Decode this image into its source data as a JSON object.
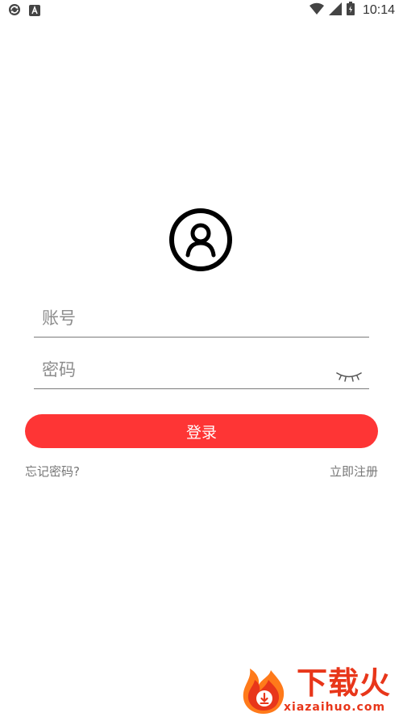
{
  "status_bar": {
    "time": "10:14",
    "left_icons": [
      "sync-icon",
      "a-badge-icon"
    ],
    "right_icons": [
      "wifi-icon",
      "signal-icon",
      "battery-icon"
    ]
  },
  "avatar": {
    "icon": "user-avatar-icon"
  },
  "account_field": {
    "placeholder": "账号",
    "value": ""
  },
  "password_field": {
    "placeholder": "密码",
    "value": "",
    "toggle_icon": "eye-closed-icon"
  },
  "login_button": {
    "label": "登录",
    "color": "#fe3535"
  },
  "links": {
    "forgot": "忘记密码?",
    "register": "立即注册"
  },
  "watermark": {
    "brand": "下载火",
    "url": "xiazaihuo.com",
    "color": "#e8361a"
  }
}
